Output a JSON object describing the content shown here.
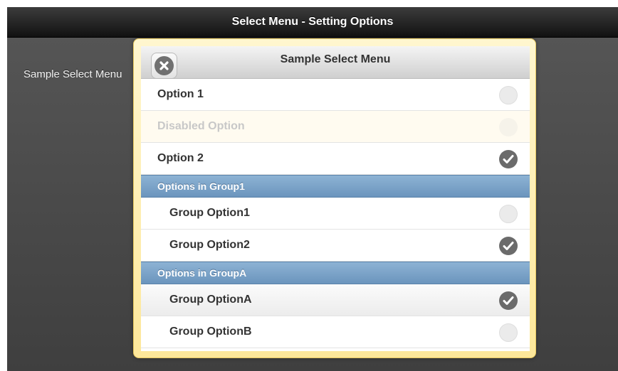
{
  "page": {
    "title": "Select Menu - Setting Options",
    "select_label": "Sample Select Menu"
  },
  "dialog": {
    "title": "Sample Select Menu",
    "close_icon": "close-x-circle-icon",
    "options": [
      {
        "label": "Option 1",
        "selected": false,
        "disabled": false
      },
      {
        "label": "Disabled Option",
        "selected": false,
        "disabled": true
      },
      {
        "label": "Option 2",
        "selected": true,
        "disabled": false
      }
    ],
    "groups": [
      {
        "label": "Options in Group1",
        "options": [
          {
            "label": "Group Option1",
            "selected": false
          },
          {
            "label": "Group Option2",
            "selected": true
          }
        ]
      },
      {
        "label": "Options in GroupA",
        "options": [
          {
            "label": "Group OptionA",
            "selected": true
          },
          {
            "label": "Group OptionB",
            "selected": false
          }
        ]
      }
    ]
  },
  "colors": {
    "header_bg": "#1a1a1a",
    "group_header_bg": "#7aa2c8",
    "dialog_border": "#fde79a",
    "check_on": "#6b6b6b",
    "check_off": "#ebebeb"
  }
}
